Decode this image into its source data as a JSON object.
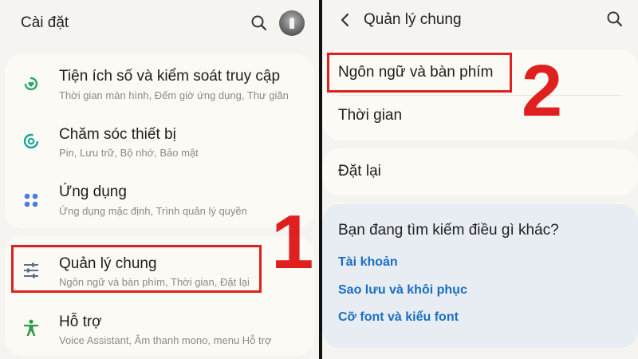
{
  "left": {
    "header": {
      "title": "Cài đặt",
      "search_icon": "search-icon",
      "avatar": "avatar"
    },
    "items": [
      {
        "title": "Tiện ích số và kiểm soát truy cập",
        "subtitle": "Thời gian màn hình, Đếm giờ ứng dụng, Thư giãn",
        "icon": "digital-wellbeing-icon",
        "color": "#2aa66a"
      },
      {
        "title": "Chăm sóc thiết bị",
        "subtitle": "Pin, Lưu trữ, Bộ nhớ, Bảo mật",
        "icon": "device-care-icon",
        "color": "#16a79a"
      },
      {
        "title": "Ứng dụng",
        "subtitle": "Ứng dụng mặc định, Trình quản lý quyền",
        "icon": "apps-icon",
        "color": "#4a7fd6"
      },
      {
        "title": "Quản lý chung",
        "subtitle": "Ngôn ngữ và bàn phím, Thời gian, Đặt lại",
        "icon": "general-management-icon",
        "color": "#5f6f86"
      },
      {
        "title": "Hỗ trợ",
        "subtitle": "Voice Assistant, Âm thanh mono, menu Hỗ trợ",
        "icon": "accessibility-icon",
        "color": "#2f9a4a"
      }
    ],
    "step_number": "1"
  },
  "right": {
    "header": {
      "title": "Quản lý chung",
      "back_icon": "back-icon",
      "search_icon": "search-icon"
    },
    "items": [
      {
        "label": "Ngôn ngữ và bàn phím"
      },
      {
        "label": "Thời gian"
      },
      {
        "label": "Đặt lại"
      }
    ],
    "step_number": "2",
    "search_suggestions": {
      "title": "Bạn đang tìm kiếm điều gì khác?",
      "links": [
        "Tài khoản",
        "Sao lưu và khôi phục",
        "Cỡ font và kiểu font"
      ]
    }
  },
  "colors": {
    "highlight": "#e01f1f",
    "link": "#1a6fc2"
  }
}
